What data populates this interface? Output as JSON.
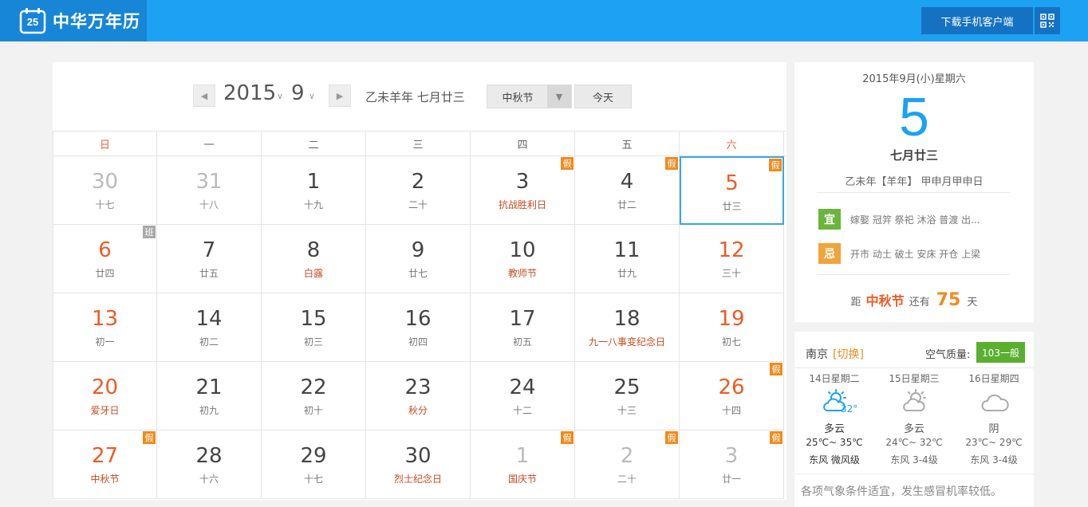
{
  "header": {
    "title": "中华万年历",
    "logo_number": "25",
    "download_label": "下载手机客户端"
  },
  "toolbar": {
    "year": "2015",
    "month": "9",
    "lunar_info": "乙未羊年 七月廿三",
    "holiday_select": "中秋节",
    "today_label": "今天"
  },
  "weekdays": [
    "日",
    "一",
    "二",
    "三",
    "四",
    "五",
    "六"
  ],
  "calendar": {
    "weeks": [
      [
        {
          "day": "30",
          "lunar": "十七",
          "other": true
        },
        {
          "day": "31",
          "lunar": "十八",
          "other": true
        },
        {
          "day": "1",
          "lunar": "十九"
        },
        {
          "day": "2",
          "lunar": "二十"
        },
        {
          "day": "3",
          "lunar": "抗战胜利日",
          "festival": true,
          "badge": "假"
        },
        {
          "day": "4",
          "lunar": "廿二",
          "badge": "假"
        },
        {
          "day": "5",
          "lunar": "廿三",
          "weekend": true,
          "selected": true,
          "badge": "假"
        }
      ],
      [
        {
          "day": "6",
          "lunar": "廿四",
          "weekend": true,
          "badge": "班",
          "badge_type": "work"
        },
        {
          "day": "7",
          "lunar": "廿五"
        },
        {
          "day": "8",
          "lunar": "白露",
          "festival": true
        },
        {
          "day": "9",
          "lunar": "廿七"
        },
        {
          "day": "10",
          "lunar": "教师节",
          "festival": true
        },
        {
          "day": "11",
          "lunar": "廿九"
        },
        {
          "day": "12",
          "lunar": "三十",
          "weekend": true
        }
      ],
      [
        {
          "day": "13",
          "lunar": "初一",
          "weekend": true
        },
        {
          "day": "14",
          "lunar": "初二"
        },
        {
          "day": "15",
          "lunar": "初三"
        },
        {
          "day": "16",
          "lunar": "初四"
        },
        {
          "day": "17",
          "lunar": "初五"
        },
        {
          "day": "18",
          "lunar": "九一八事变纪念日",
          "festival": true
        },
        {
          "day": "19",
          "lunar": "初七",
          "weekend": true
        }
      ],
      [
        {
          "day": "20",
          "lunar": "爱牙日",
          "weekend": true,
          "festival": true
        },
        {
          "day": "21",
          "lunar": "初九"
        },
        {
          "day": "22",
          "lunar": "初十"
        },
        {
          "day": "23",
          "lunar": "秋分",
          "festival": true
        },
        {
          "day": "24",
          "lunar": "十二"
        },
        {
          "day": "25",
          "lunar": "十三"
        },
        {
          "day": "26",
          "lunar": "十四",
          "weekend": true,
          "badge": "假"
        }
      ],
      [
        {
          "day": "27",
          "lunar": "中秋节",
          "weekend": true,
          "festival": true,
          "badge": "假"
        },
        {
          "day": "28",
          "lunar": "十六"
        },
        {
          "day": "29",
          "lunar": "十七"
        },
        {
          "day": "30",
          "lunar": "烈士纪念日",
          "festival": true
        },
        {
          "day": "1",
          "lunar": "国庆节",
          "other": true,
          "festival": true,
          "badge": "假"
        },
        {
          "day": "2",
          "lunar": "二十",
          "other": true,
          "badge": "假"
        },
        {
          "day": "3",
          "lunar": "廿一",
          "other": true,
          "badge": "假"
        }
      ]
    ]
  },
  "info": {
    "date_line": "2015年9月(小)星期六",
    "big_day": "5",
    "lunar_date": "七月廿三",
    "ganzhi": "乙未年【羊年】 甲申月甲申日",
    "yi_label": "宜",
    "yi_text": "嫁娶 冠笄 祭祀 沐浴 普渡 出...",
    "ji_label": "忌",
    "ji_text": "开市 动土 破土 安床 开仓 上梁",
    "countdown_prefix": "距",
    "countdown_festival": "中秋节",
    "countdown_mid": "还有",
    "countdown_days": "75",
    "countdown_suffix": "天"
  },
  "weather": {
    "city": "南京",
    "switch_label": "[切换]",
    "aqi_label": "空气质量:",
    "aqi_value": "103一般",
    "days": [
      {
        "date": "14日星期二",
        "icon": "partly-cloudy-sun-icon",
        "now_temp": "32°",
        "desc": "多云",
        "range": "25℃~ 35℃",
        "wind": "东风 微风级"
      },
      {
        "date": "15日星期三",
        "icon": "partly-cloudy-sun-icon",
        "now_temp": "",
        "desc": "多云",
        "range": "24℃~ 32℃",
        "wind": "东风 3-4级"
      },
      {
        "date": "16日星期四",
        "icon": "cloud-icon",
        "now_temp": "",
        "desc": "阴",
        "range": "23℃~ 29℃",
        "wind": "东风 3-4级"
      }
    ],
    "tip": "各项气象条件适宜，发生感冒机率较低。"
  },
  "colors": {
    "brand_blue": "#1da1f2",
    "weekend_red": "#f05a23",
    "holiday_badge": "#f08b1d",
    "work_badge": "#a9a9a9",
    "yi_green": "#6bb53d",
    "ji_orange": "#f0a43a"
  }
}
